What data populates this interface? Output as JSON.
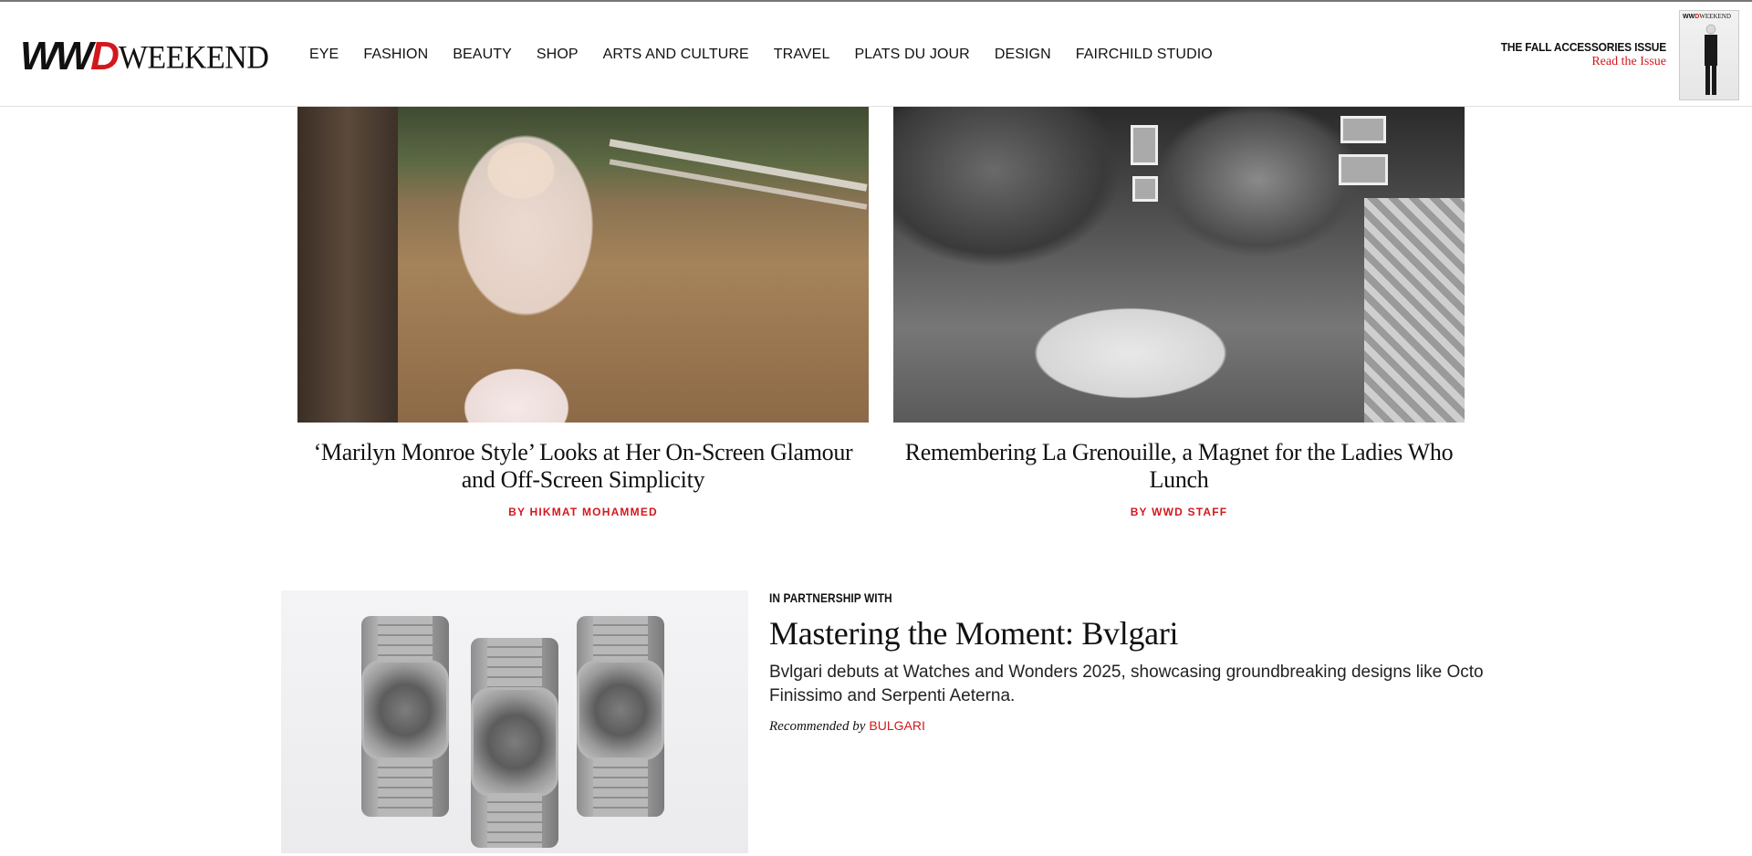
{
  "header": {
    "logo_main": "WWD",
    "logo_main_w": "WW",
    "logo_main_d": "D",
    "logo_sub": "WEEKEND",
    "nav": [
      "EYE",
      "FASHION",
      "BEAUTY",
      "SHOP",
      "ARTS AND CULTURE",
      "TRAVEL",
      "PLATS DU JOUR",
      "DESIGN",
      "FAIRCHILD STUDIO"
    ],
    "issue_title": "THE FALL ACCESSORIES ISSUE",
    "issue_link": "Read the Issue",
    "cover_masthead_w": "WW",
    "cover_masthead_d": "D",
    "cover_masthead_sub": "WEEKEND"
  },
  "stories": [
    {
      "title": "‘Marilyn Monroe Style’ Looks at Her On-Screen Glamour and Off-Screen Simplicity",
      "byline": "BY HIKMAT MOHAMMED"
    },
    {
      "title": "Remembering La Grenouille, a Magnet for the Ladies Who Lunch",
      "byline": "BY WWD STAFF"
    }
  ],
  "sponsored": {
    "kicker": "IN PARTNERSHIP WITH",
    "title": "Mastering the Moment: Bvlgari",
    "description": "Bvlgari debuts at Watches and Wonders 2025, showcasing groundbreaking designs like Octo Finissimo and Serpenti Aeterna.",
    "recommended_label": "Recommended by",
    "brand": "BULGARI"
  },
  "colors": {
    "accent_red": "#d3181d",
    "text": "#111111"
  }
}
